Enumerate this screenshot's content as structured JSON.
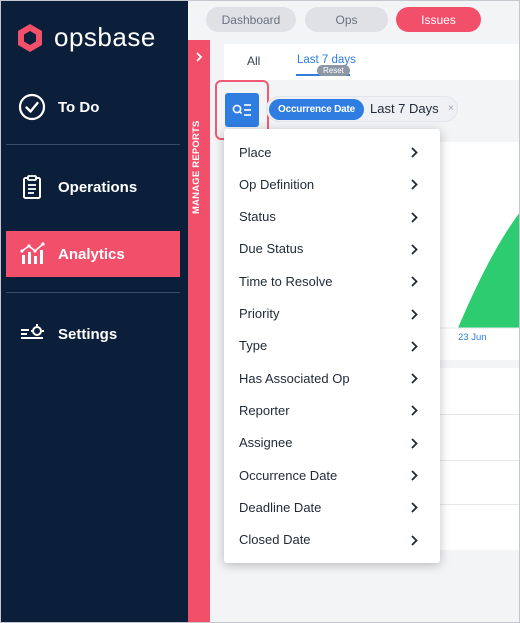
{
  "app": {
    "brand": "opsbase",
    "colors": {
      "sidebar": "#0b1f3a",
      "accent": "#f24f6b",
      "primary": "#2f7de1",
      "chart_fill": "#2ecc71"
    }
  },
  "sidebar": {
    "items": [
      {
        "label": "To Do",
        "icon": "check-circle-icon"
      },
      {
        "label": "Operations",
        "icon": "clipboard-icon"
      },
      {
        "label": "Analytics",
        "icon": "analytics-icon",
        "active": true
      },
      {
        "label": "Settings",
        "icon": "settings-sliders-icon"
      }
    ]
  },
  "manage_reports": {
    "label": "MANAGE REPORTS"
  },
  "top_tabs": [
    {
      "label": "Dashboard"
    },
    {
      "label": "Ops"
    },
    {
      "label": "Issues",
      "active": true
    }
  ],
  "sub_tabs": {
    "all": "All",
    "last7": "Last 7 days",
    "reset": "Reset"
  },
  "filter": {
    "chip_label": "Occurrence Date",
    "chip_value": "Last 7 Days",
    "close": "×"
  },
  "chart": {
    "date_label": "23 Jun"
  },
  "dropdown": {
    "items": [
      "Place",
      "Op Definition",
      "Status",
      "Due Status",
      "Time to Resolve",
      "Priority",
      "Type",
      "Has Associated Op",
      "Reporter",
      "Assignee",
      "Occurrence Date",
      "Deadline Date",
      "Closed Date"
    ]
  }
}
